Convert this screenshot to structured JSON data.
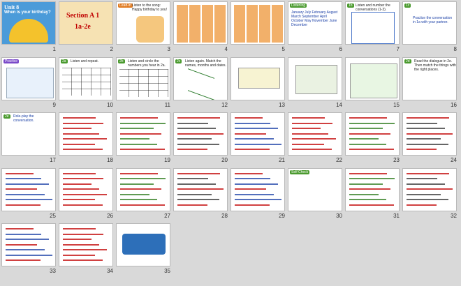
{
  "slides": [
    {
      "n": "1",
      "title": "Unit 8",
      "sub": "When is your birthday?"
    },
    {
      "n": "2",
      "title": "Section A 1",
      "sub": "1a-2e"
    },
    {
      "n": "3",
      "title": "Lead-in",
      "sub": "Listen to the song: Happy birthday to you!"
    },
    {
      "n": "4",
      "title": "",
      "sub": ""
    },
    {
      "n": "5",
      "title": "",
      "sub": ""
    },
    {
      "n": "6",
      "title": "Listening",
      "sub": "January July February August March September April October May November June December"
    },
    {
      "n": "7",
      "title": "1b",
      "sub": "Listen and number the conversations (1-3)."
    },
    {
      "n": "8",
      "title": "1c",
      "sub": "Practice the conversation in 1a with your partner."
    },
    {
      "n": "9",
      "title": "Practice",
      "sub": ""
    },
    {
      "n": "10",
      "title": "2a",
      "sub": "Listen and repeat."
    },
    {
      "n": "11",
      "title": "2b",
      "sub": "Listen and circle the numbers you hear in 2a."
    },
    {
      "n": "12",
      "title": "2c",
      "sub": "Listen again. Match the names, months and dates."
    },
    {
      "n": "13",
      "title": "",
      "sub": ""
    },
    {
      "n": "14",
      "title": "",
      "sub": ""
    },
    {
      "n": "15",
      "title": "",
      "sub": ""
    },
    {
      "n": "16",
      "title": "2d",
      "sub": "Read the dialogue in 2e. Then match the things with the right places."
    },
    {
      "n": "17",
      "title": "2e",
      "sub": "Role-play the conversation."
    },
    {
      "n": "18",
      "title": "",
      "sub": ""
    },
    {
      "n": "19",
      "title": "",
      "sub": ""
    },
    {
      "n": "20",
      "title": "",
      "sub": ""
    },
    {
      "n": "21",
      "title": "",
      "sub": ""
    },
    {
      "n": "22",
      "title": "",
      "sub": ""
    },
    {
      "n": "23",
      "title": "",
      "sub": ""
    },
    {
      "n": "24",
      "title": "",
      "sub": ""
    },
    {
      "n": "25",
      "title": "",
      "sub": ""
    },
    {
      "n": "26",
      "title": "",
      "sub": ""
    },
    {
      "n": "27",
      "title": "",
      "sub": ""
    },
    {
      "n": "28",
      "title": "",
      "sub": ""
    },
    {
      "n": "29",
      "title": "",
      "sub": ""
    },
    {
      "n": "30",
      "title": "Self Check",
      "sub": ""
    },
    {
      "n": "31",
      "title": "",
      "sub": ""
    },
    {
      "n": "32",
      "title": "",
      "sub": ""
    },
    {
      "n": "33",
      "title": "",
      "sub": ""
    },
    {
      "n": "34",
      "title": "",
      "sub": ""
    },
    {
      "n": "35",
      "title": "",
      "sub": ""
    }
  ],
  "colors": {
    "title": "#c00000",
    "tag": "#e07a1f",
    "badge": "#4a9a2e"
  }
}
